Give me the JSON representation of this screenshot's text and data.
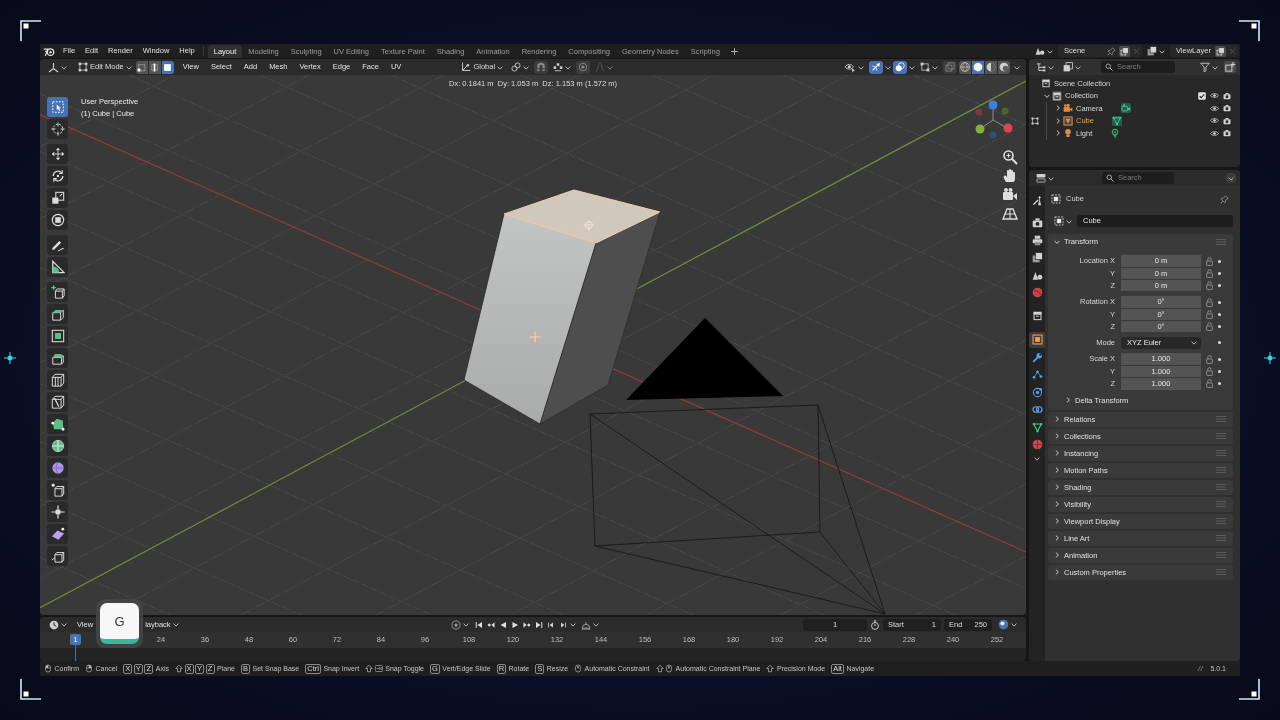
{
  "topbar": {
    "menus": [
      "File",
      "Edit",
      "Render",
      "Window",
      "Help"
    ],
    "workspaces": [
      {
        "label": "Layout",
        "selected": true
      },
      {
        "label": "Modeling",
        "selected": false
      },
      {
        "label": "Sculpting",
        "selected": false
      },
      {
        "label": "UV Editing",
        "selected": false
      },
      {
        "label": "Texture Paint",
        "selected": false
      },
      {
        "label": "Shading",
        "selected": false
      },
      {
        "label": "Animation",
        "selected": false
      },
      {
        "label": "Rendering",
        "selected": false
      },
      {
        "label": "Compositing",
        "selected": false
      },
      {
        "label": "Geometry Nodes",
        "selected": false
      },
      {
        "label": "Scripting",
        "selected": false
      }
    ],
    "scene": "Scene",
    "view_layer": "ViewLayer"
  },
  "viewport_header": {
    "mode": "Edit Mode",
    "select_modes": [
      {
        "selected": false
      },
      {
        "selected": false
      },
      {
        "selected": true
      }
    ],
    "menus": [
      "View",
      "Select",
      "Add",
      "Mesh",
      "Vertex",
      "Edge",
      "Face",
      "UV"
    ],
    "orientation": "Global",
    "snap": {
      "on": false
    },
    "proportional_editing": {
      "on": false
    },
    "gizmos": {
      "on": true
    },
    "overlays": {
      "on": true
    },
    "xray": {
      "on": false
    },
    "shading": [
      {
        "selected": false
      },
      {
        "selected": true
      },
      {
        "selected": false
      },
      {
        "selected": false
      }
    ]
  },
  "viewport": {
    "readout": "Dx: 0.1841 m  Dy: 1.053 m  Dz: 1.153 m (1.572 m)",
    "view_name": "User Perspective",
    "object_info": "(1) Cube | Cube",
    "tools": [
      {
        "selected": true
      },
      {
        "selected": false
      },
      {
        "selected": false
      },
      {
        "selected": false
      },
      {
        "selected": false
      },
      {
        "selected": false
      },
      {
        "selected": false
      },
      {
        "selected": false
      },
      {
        "selected": false
      },
      {
        "selected": false
      },
      {
        "selected": false
      },
      {
        "selected": false
      },
      {
        "selected": false
      },
      {
        "selected": false
      },
      {
        "selected": false
      },
      {
        "selected": false
      },
      {
        "selected": false
      },
      {
        "selected": false
      },
      {
        "selected": false
      },
      {
        "selected": false
      },
      {
        "selected": false
      }
    ]
  },
  "outliner": {
    "search": {
      "placeholder": "Search"
    },
    "tree": [
      {
        "label": "Scene Collection",
        "kind": "scene_collection",
        "selected": false,
        "active": false,
        "children": [
          {
            "label": "Collection",
            "kind": "collection",
            "selected": false,
            "active": true,
            "expanded": true,
            "checked": true,
            "children": [
              {
                "label": "Camera",
                "kind": "camera",
                "selected": false,
                "active": false,
                "expanded": false,
                "edit_mode": false
              },
              {
                "label": "Cube",
                "kind": "mesh",
                "selected": true,
                "active": true,
                "expanded": false,
                "edit_mode": true
              },
              {
                "label": "Light",
                "kind": "light",
                "selected": false,
                "active": false,
                "expanded": false,
                "edit_mode": false
              }
            ]
          }
        ]
      }
    ]
  },
  "properties": {
    "search": {
      "placeholder": "Search"
    },
    "tabs": [
      {
        "selected": false
      },
      {
        "selected": false
      },
      {
        "selected": false
      },
      {
        "selected": false
      },
      {
        "selected": false
      },
      {
        "selected": false
      },
      {
        "selected": false
      },
      {
        "selected": true
      },
      {
        "selected": false
      },
      {
        "selected": false
      },
      {
        "selected": false
      },
      {
        "selected": false
      },
      {
        "selected": false
      },
      {
        "selected": false
      }
    ],
    "title": "Cube",
    "name": "Cube",
    "panels": [
      {
        "label": "Transform",
        "expanded": true,
        "groups": [
          {
            "rows": [
              {
                "kind": "number",
                "label": "Location X",
                "value": "0 m"
              },
              {
                "kind": "number",
                "label": "Y",
                "value": "0 m"
              },
              {
                "kind": "number",
                "label": "Z",
                "value": "0 m"
              }
            ]
          },
          {
            "rows": [
              {
                "kind": "number",
                "label": "Rotation X",
                "value": "0°"
              },
              {
                "kind": "number",
                "label": "Y",
                "value": "0°"
              },
              {
                "kind": "number",
                "label": "Z",
                "value": "0°"
              }
            ]
          },
          {
            "rows": [
              {
                "kind": "dropdown",
                "label": "Mode",
                "value": "XYZ Euler"
              }
            ]
          },
          {
            "rows": [
              {
                "kind": "number",
                "label": "Scale X",
                "value": "1.000"
              },
              {
                "kind": "number",
                "label": "Y",
                "value": "1.000"
              },
              {
                "kind": "number",
                "label": "Z",
                "value": "1.000"
              }
            ]
          }
        ],
        "subpanels": [
          {
            "label": "Delta Transform",
            "expanded": false
          }
        ]
      },
      {
        "label": "Relations",
        "expanded": false
      },
      {
        "label": "Collections",
        "expanded": false
      },
      {
        "label": "Instancing",
        "expanded": false
      },
      {
        "label": "Motion Paths",
        "expanded": false
      },
      {
        "label": "Shading",
        "expanded": false
      },
      {
        "label": "Visibility",
        "expanded": false
      },
      {
        "label": "Viewport Display",
        "expanded": false
      },
      {
        "label": "Line Art",
        "expanded": false
      },
      {
        "label": "Animation",
        "expanded": false
      },
      {
        "label": "Custom Properties",
        "expanded": false
      }
    ]
  },
  "timeline": {
    "menus": [
      "View"
    ],
    "playback_popover": "layback",
    "current_frame": "1",
    "start_label": "Start",
    "start": "1",
    "end_label": "End",
    "end": "250",
    "playhead": "1",
    "ruler": [
      "24",
      "36",
      "48",
      "60",
      "72",
      "84",
      "96",
      "108",
      "120",
      "132",
      "144",
      "156",
      "168",
      "180",
      "192",
      "204",
      "216",
      "228",
      "240",
      "252"
    ]
  },
  "key_overlay": {
    "key": "G"
  },
  "status_bar": {
    "hints": [
      {
        "keys": [
          {
            "kind": "lmb"
          }
        ],
        "label": "Confirm"
      },
      {
        "keys": [
          {
            "kind": "rmb"
          }
        ],
        "label": "Cancel"
      },
      {
        "keys": [
          {
            "kind": "key",
            "text": "X"
          },
          {
            "kind": "key",
            "text": "Y"
          },
          {
            "kind": "key",
            "text": "Z"
          }
        ],
        "label": "Axis"
      },
      {
        "keys": [
          {
            "kind": "shift"
          },
          {
            "kind": "key",
            "text": "X"
          },
          {
            "kind": "key",
            "text": "Y"
          },
          {
            "kind": "key",
            "text": "Z"
          }
        ],
        "label": "Plane"
      },
      {
        "keys": [
          {
            "kind": "key",
            "text": "B"
          }
        ],
        "label": "Set Snap Base"
      },
      {
        "keys": [
          {
            "kind": "key",
            "text": "Ctrl"
          }
        ],
        "label": "Snap Invert"
      },
      {
        "keys": [
          {
            "kind": "shift"
          },
          {
            "kind": "tab"
          }
        ],
        "label": "Snap Toggle"
      },
      {
        "keys": [
          {
            "kind": "key",
            "text": "G"
          }
        ],
        "label": "Vert/Edge Slide"
      },
      {
        "keys": [
          {
            "kind": "key",
            "text": "R"
          }
        ],
        "label": "Rotate"
      },
      {
        "keys": [
          {
            "kind": "key",
            "text": "S"
          }
        ],
        "label": "Resize"
      },
      {
        "keys": [
          {
            "kind": "mmb"
          }
        ],
        "label": "Automatic Constraint"
      },
      {
        "keys": [
          {
            "kind": "shift"
          },
          {
            "kind": "mmb"
          }
        ],
        "label": "Automatic Constraint Plane"
      },
      {
        "keys": [
          {
            "kind": "shift"
          }
        ],
        "label": "Precision Mode"
      },
      {
        "keys": [
          {
            "kind": "key",
            "text": "Alt"
          }
        ],
        "label": "Navigate"
      }
    ],
    "version": "5.0.1"
  }
}
